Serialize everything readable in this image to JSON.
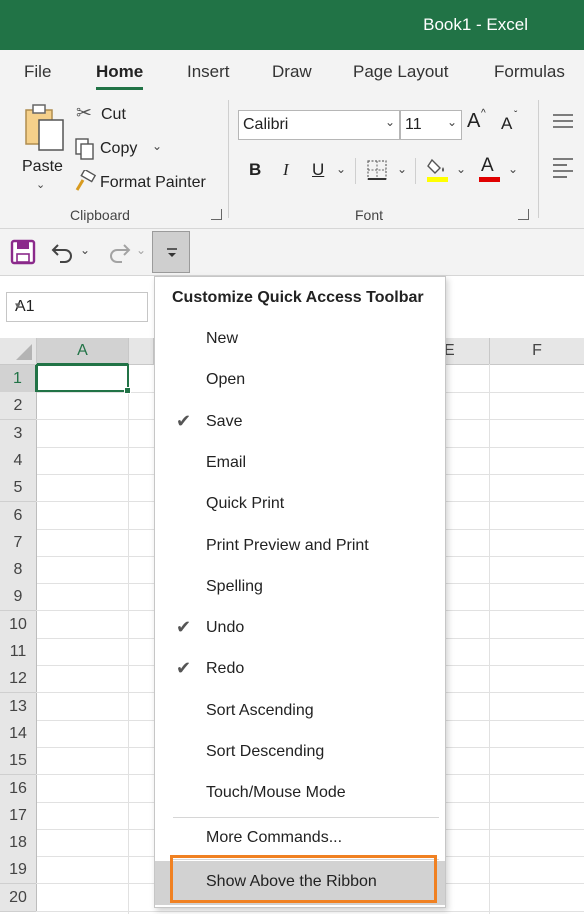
{
  "window": {
    "title": "Book1  -  Excel"
  },
  "ribbon_tabs": [
    "File",
    "Home",
    "Insert",
    "Draw",
    "Page Layout",
    "Formulas"
  ],
  "clipboard": {
    "paste_label": "Paste",
    "cut_label": "Cut",
    "copy_label": "Copy",
    "format_painter_label": "Format Painter",
    "group_label": "Clipboard"
  },
  "font": {
    "name": "Calibri",
    "size": "11",
    "bold": "B",
    "italic": "I",
    "underline": "U",
    "grow_icon": "A",
    "shrink_icon": "A",
    "font_color_icon": "A",
    "group_label": "Font",
    "highlight_color": "#ffff00",
    "font_color": "#e00000"
  },
  "namebox": {
    "value": "A1"
  },
  "columns": [
    "A",
    "E",
    "F"
  ],
  "rows": [
    "1",
    "2",
    "3",
    "4",
    "5",
    "6",
    "7",
    "8",
    "9",
    "10",
    "11",
    "12",
    "13",
    "14",
    "15",
    "16",
    "17",
    "18",
    "19",
    "20"
  ],
  "menu": {
    "header": "Customize Quick Access Toolbar",
    "items": [
      {
        "label": "New",
        "checked": false
      },
      {
        "label": "Open",
        "checked": false
      },
      {
        "label": "Save",
        "checked": true
      },
      {
        "label": "Email",
        "checked": false
      },
      {
        "label": "Quick Print",
        "checked": false
      },
      {
        "label": "Print Preview and Print",
        "checked": false
      },
      {
        "label": "Spelling",
        "checked": false
      },
      {
        "label": "Undo",
        "checked": true
      },
      {
        "label": "Redo",
        "checked": true
      },
      {
        "label": "Sort Ascending",
        "checked": false
      },
      {
        "label": "Sort Descending",
        "checked": false
      },
      {
        "label": "Touch/Mouse Mode",
        "checked": false
      }
    ],
    "more_commands": "More Commands...",
    "show_above": "Show Above the Ribbon",
    "check_glyph": "✔"
  },
  "colors": {
    "brand": "#217346",
    "focus_outline": "#f08122"
  }
}
